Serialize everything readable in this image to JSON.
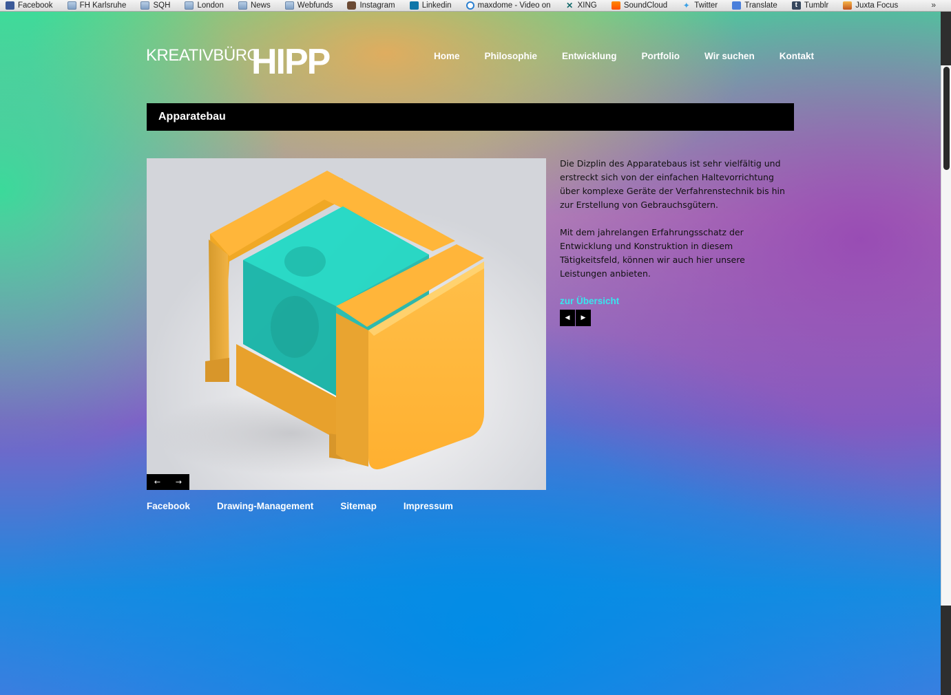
{
  "bookmarks": [
    {
      "label": "Facebook",
      "icon": "facebook-icon"
    },
    {
      "label": "FH Karlsruhe",
      "icon": "folder-icon"
    },
    {
      "label": "SQH",
      "icon": "folder-icon"
    },
    {
      "label": "London",
      "icon": "folder-icon"
    },
    {
      "label": "News",
      "icon": "folder-icon"
    },
    {
      "label": "Webfunds",
      "icon": "folder-icon"
    },
    {
      "label": "Instagram",
      "icon": "instagram-icon"
    },
    {
      "label": "Linkedin",
      "icon": "linkedin-icon"
    },
    {
      "label": "maxdome - Video on",
      "icon": "maxdome-icon"
    },
    {
      "label": "XING",
      "icon": "xing-icon"
    },
    {
      "label": "SoundCloud",
      "icon": "soundcloud-icon"
    },
    {
      "label": "Twitter",
      "icon": "twitter-icon"
    },
    {
      "label": "Translate",
      "icon": "translate-icon"
    },
    {
      "label": "Tumblr",
      "icon": "tumblr-icon"
    },
    {
      "label": "Juxta Focus",
      "icon": "juxta-icon"
    }
  ],
  "bookmarks_more": "»",
  "logo": {
    "prefix": "KREATIVBÜRO",
    "name": "HIPP"
  },
  "nav": [
    "Home",
    "Philosophie",
    "Entwicklung",
    "Portfolio",
    "Wir suchen",
    "Kontakt"
  ],
  "page_title": "Apparatebau",
  "slider": {
    "prev": "←",
    "next": "→",
    "image": "orange-apparatus-render"
  },
  "text": {
    "p1": "Die Dizplin des Apparatebaus ist sehr vielfältig und erstreckt sich von der einfachen Haltevorrichtung über komplexe Geräte der Verfahrenstechnik bis hin zur Erstellung von Gebrauchsgütern.",
    "p2": "Mit dem jahrelangen Erfahrungsschatz der Entwicklung und Konstruktion in diesem Tätigkeitsfeld, können wir auch hier unsere Leistungen anbieten.",
    "overview_link": "zur Übersicht"
  },
  "pager": {
    "prev": "◀",
    "next": "▶"
  },
  "footer": [
    "Facebook",
    "Drawing-Management",
    "Sitemap",
    "Impressum"
  ],
  "colors": {
    "accent": "#38e6ee",
    "title_bg": "#000000",
    "device_orange": "#ffb43a",
    "glass": "#1cc7b8"
  }
}
